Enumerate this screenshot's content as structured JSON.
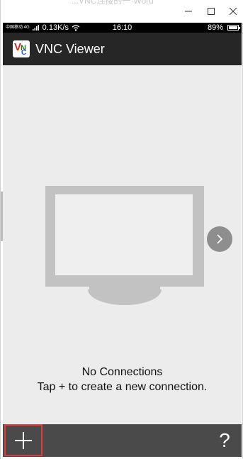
{
  "window": {
    "ghost_title": "...VNC连接的一·Word",
    "minimize_icon": "minimize-icon",
    "maximize_icon": "maximize-icon",
    "close_icon": "close-icon"
  },
  "status_bar": {
    "carrier": "中国移动 4G",
    "speed": "0.13K/s",
    "time": "16:10",
    "battery": "89%"
  },
  "app_bar": {
    "title": "VNC Viewer",
    "logo_letters": [
      "V",
      "N",
      "C"
    ]
  },
  "content": {
    "empty_title": "No Connections",
    "empty_subtitle": "Tap + to create a new connection.",
    "next_icon": "chevron-right-icon"
  },
  "bottom_bar": {
    "add_icon": "plus-icon",
    "help_label": "?",
    "highlight_color": "#e23a3a"
  },
  "colors": {
    "app_bar": "#262626",
    "content_bg": "#ececec",
    "monitor": "#c2c2c2",
    "bottom_bar": "#4a4a4a"
  }
}
